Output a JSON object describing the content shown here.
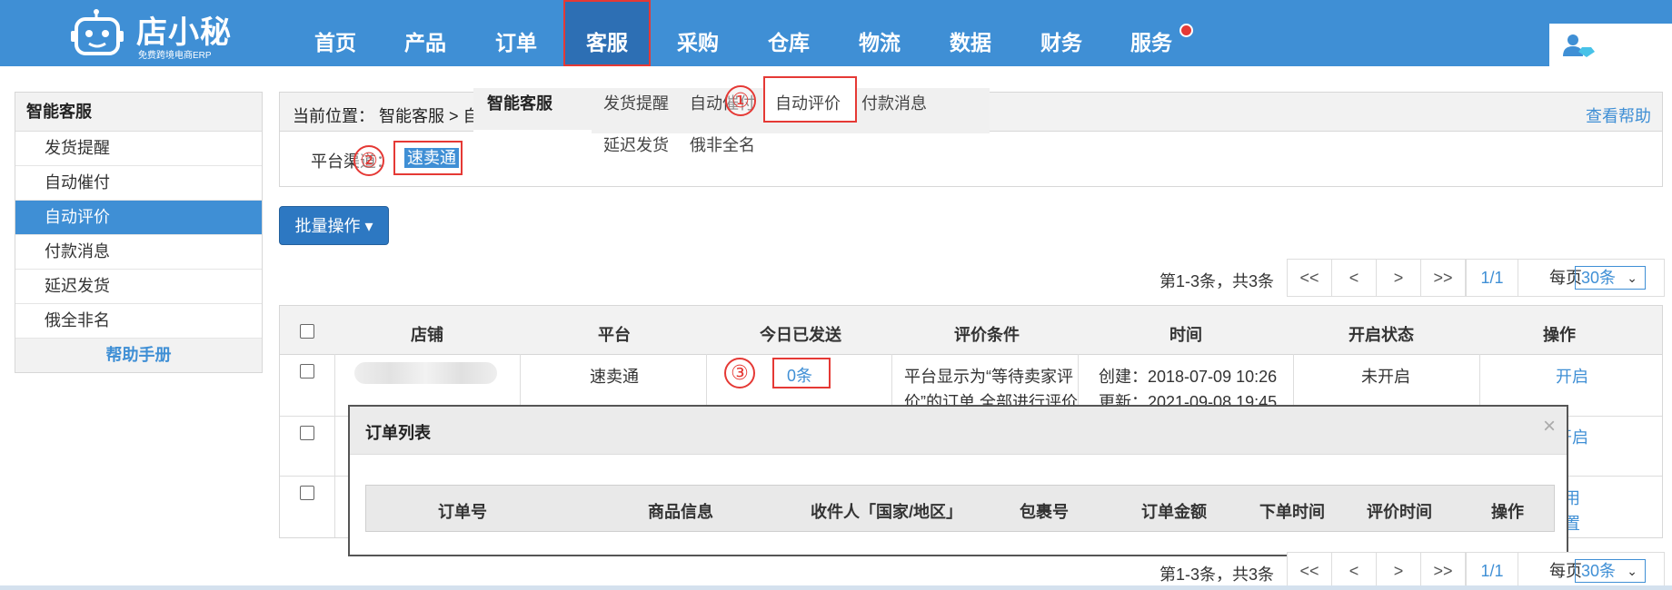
{
  "app": {
    "logo_name": "店小秘",
    "logo_tagline": "免费跨境电商ERP"
  },
  "nav": {
    "items": [
      "首页",
      "产品",
      "订单",
      "客服",
      "采购",
      "仓库",
      "物流",
      "数据",
      "财务",
      "服务"
    ],
    "active": "客服"
  },
  "sidebar": {
    "title": "智能客服",
    "items": [
      "发货提醒",
      "自动催付",
      "自动评价",
      "付款消息",
      "延迟发货",
      "俄全非名"
    ],
    "selected": "自动评价",
    "footer": "帮助手册"
  },
  "breadcrumb": {
    "text": "当前位置：  智能客服 > 自",
    "help": "查看帮助"
  },
  "submenu": {
    "title": "智能客服",
    "row1": [
      "发货提醒",
      "自动催付",
      "自动评价",
      "付款消息"
    ],
    "row2": [
      "延迟发货",
      "俄非全名"
    ]
  },
  "filter": {
    "label": "平台渠道：",
    "chip": "速卖通"
  },
  "markers": [
    "①",
    "②",
    "③"
  ],
  "batch_button": "批量操作 ▾",
  "pagination": {
    "info": "第1-3条，共3条",
    "first": "<<",
    "prev": "<",
    "next": ">",
    "last": ">>",
    "page": "1/1",
    "per_page_label": "每页",
    "per_page_value": "30条"
  },
  "table": {
    "headers": [
      "店铺",
      "平台",
      "今日已发送",
      "评价条件",
      "时间",
      "开启状态",
      "操作"
    ],
    "row1": {
      "platform": "速卖通",
      "sent": "0条",
      "condition_line1": "平台显示为“等待卖家评",
      "condition_line2": "价”的订单,全部进行评价",
      "created": "创建：2018-07-09 10:26",
      "updated": "更新：2021-09-08 19:45",
      "status": "未开启",
      "action": "开启"
    },
    "row2": {
      "action": "开启"
    },
    "row3": {
      "action_line1": "用",
      "action_line2": "置"
    }
  },
  "modal": {
    "title": "订单列表",
    "close": "×",
    "headers": [
      "订单号",
      "商品信息",
      "收件人「国家/地区」",
      "包裹号",
      "订单金额",
      "下单时间",
      "评价时间",
      "操作"
    ]
  },
  "colors": {
    "primary": "#3f8fd5",
    "highlight": "#e53935"
  }
}
